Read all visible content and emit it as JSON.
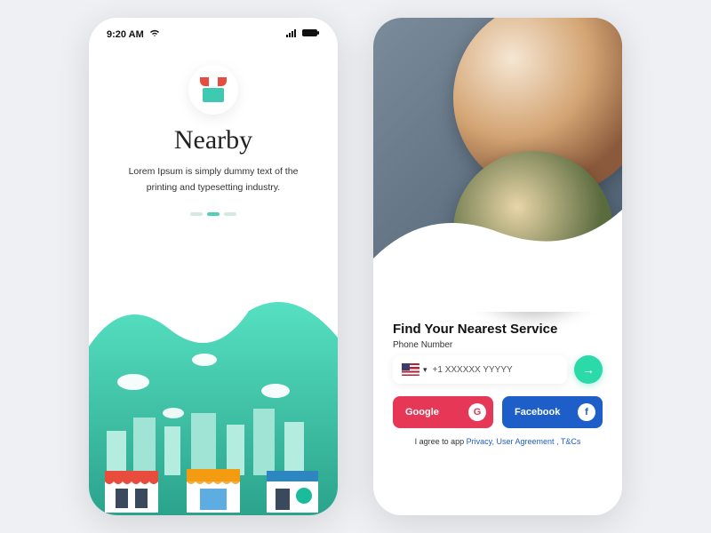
{
  "status": {
    "time": "9:20 AM"
  },
  "onboarding": {
    "title": "Nearby",
    "description": "Lorem Ipsum is simply dummy text of the printing and typesetting industry."
  },
  "login": {
    "title": "Find Your Nearest Service",
    "phone_label": "Phone Number",
    "phone_placeholder": "+1  XXXXXX YYYYY",
    "google_label": "Google",
    "facebook_label": "Facebook",
    "terms_prefix": "I agree to app ",
    "terms_links": "Privacy, User Agreement , T&Cs"
  }
}
